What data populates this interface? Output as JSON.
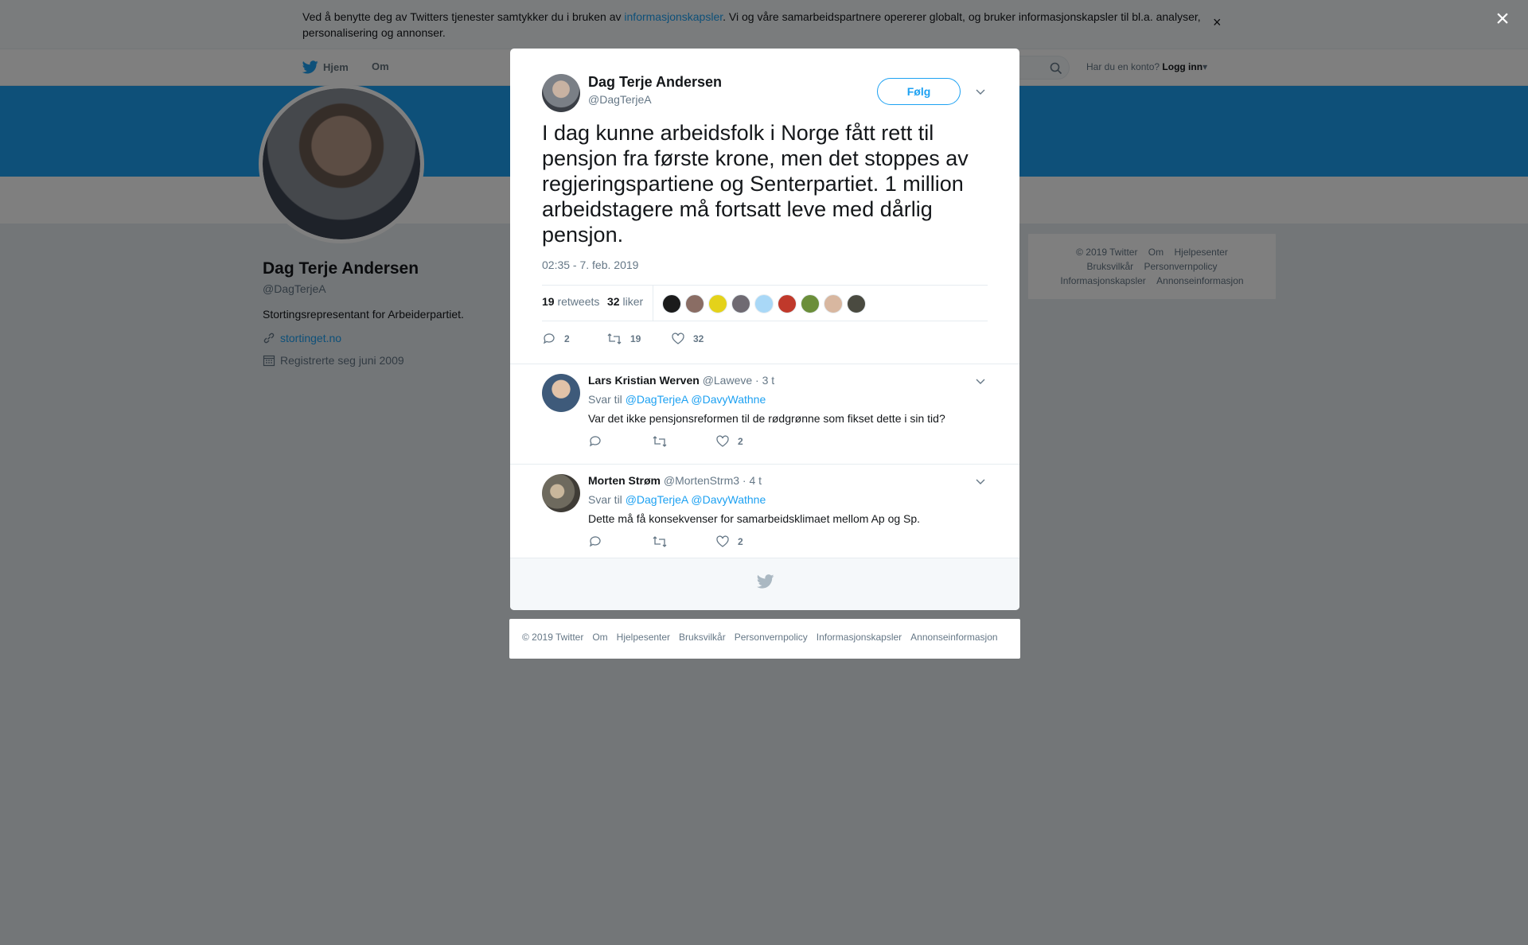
{
  "cookie": {
    "text_before": "Ved å benytte deg av Twitters tjenester samtykker du i bruken av ",
    "link": "informasjonskapsler",
    "text_after": ". Vi og våre samarbeidspartnere opererer globalt, og bruker informasjonskapsler til bl.a. analyser, personalisering og annonser.",
    "close": "×"
  },
  "nav": {
    "home": "Hjem",
    "about": "Om",
    "login_prompt": "Har du en konto?",
    "login": "Logg inn"
  },
  "profile": {
    "name": "Dag Terje Andersen",
    "handle": "@DagTerjeA",
    "bio": "Stortingsrepresentant for Arbeiderpartiet.",
    "link": "stortinget.no",
    "joined": "Registrerte seg juni 2009"
  },
  "side_footer": [
    "© 2019 Twitter",
    "Om",
    "Hjelpesenter",
    "Bruksvilkår",
    "Personvernpolicy",
    "Informasjonskapsler",
    "Annonseinformasjon"
  ],
  "overlay_close": "×",
  "tweet": {
    "name": "Dag Terje Andersen",
    "handle": "@DagTerjeA",
    "follow": "Følg",
    "text": "I dag kunne arbeidsfolk i Norge fått rett til pensjon fra første krone, men det stoppes av regjeringspartiene og Senterpartiet. 1 million arbeidstagere må fortsatt leve med dårlig pensjon.",
    "time": "02:35 - 7. feb. 2019",
    "retweets_count": "19",
    "retweets_label": "retweets",
    "likes_count": "32",
    "likes_label": "liker",
    "replies": "2",
    "retweets": "19",
    "likes": "32",
    "liker_colors": [
      "#1b1b1b",
      "#8a6d64",
      "#e4d21a",
      "#6f6a72",
      "#a9d8f7",
      "#c0392b",
      "#6b8e3a",
      "#d8b7a0",
      "#4a4a40"
    ]
  },
  "replies": [
    {
      "name": "Lars Kristian Werven",
      "handle": "@Laweve",
      "time": "· 3 t",
      "reply_to_label": "Svar til",
      "mention1": "@DagTerjeA",
      "mention2": "@DavyWathne",
      "text": "Var det ikke pensjonsreformen til de rødgrønne som fikset dette i sin tid?",
      "likes": "2",
      "avatar_color": "#3e5a7a"
    },
    {
      "name": "Morten Strøm",
      "handle": "@MortenStrm3",
      "time": "· 4 t",
      "reply_to_label": "Svar til",
      "mention1": "@DagTerjeA",
      "mention2": "@DavyWathne",
      "text": "Dette må få konsekvenser for samarbeidsklimaet mellom Ap og Sp.",
      "likes": "2",
      "avatar_color": "#6e6a5e"
    }
  ],
  "footer": [
    "© 2019 Twitter",
    "Om",
    "Hjelpesenter",
    "Bruksvilkår",
    "Personvernpolicy",
    "Informasjonskapsler",
    "Annonseinformasjon"
  ],
  "colors": {
    "accent": "#1da1f2",
    "overlay": "rgba(0,0,0,0.5)"
  }
}
